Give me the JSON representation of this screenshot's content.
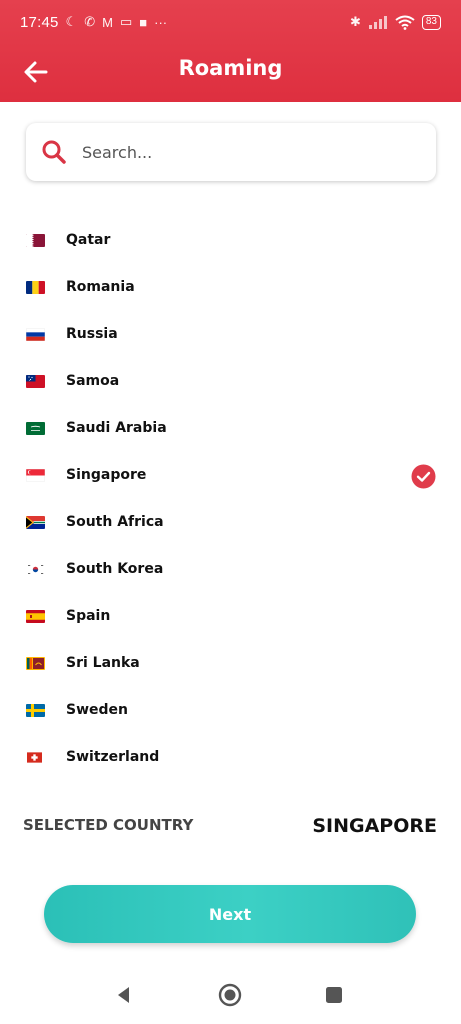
{
  "status_bar": {
    "time": "17:45",
    "battery": "83",
    "left_icons": [
      "moon-icon",
      "call-off-icon",
      "gmail-icon",
      "cast-icon",
      "square-icon",
      "more-icon"
    ],
    "right_icons": [
      "bluetooth-icon",
      "signal-icon",
      "wifi-icon",
      "battery-icon"
    ]
  },
  "header": {
    "title": "Roaming",
    "color": "#e23a48"
  },
  "search": {
    "placeholder": "Search..."
  },
  "countries": [
    {
      "name": "Qatar",
      "flag": "qatar-flag",
      "selected": false
    },
    {
      "name": "Romania",
      "flag": "romania-flag",
      "selected": false
    },
    {
      "name": "Russia",
      "flag": "russia-flag",
      "selected": false
    },
    {
      "name": "Samoa",
      "flag": "samoa-flag",
      "selected": false
    },
    {
      "name": "Saudi Arabia",
      "flag": "saudi-arabia-flag",
      "selected": false
    },
    {
      "name": "Singapore",
      "flag": "singapore-flag",
      "selected": true
    },
    {
      "name": "South Africa",
      "flag": "south-africa-flag",
      "selected": false
    },
    {
      "name": "South Korea",
      "flag": "south-korea-flag",
      "selected": false
    },
    {
      "name": "Spain",
      "flag": "spain-flag",
      "selected": false
    },
    {
      "name": "Sri Lanka",
      "flag": "sri-lanka-flag",
      "selected": false
    },
    {
      "name": "Sweden",
      "flag": "sweden-flag",
      "selected": false
    },
    {
      "name": "Switzerland",
      "flag": "switzerland-flag",
      "selected": false
    }
  ],
  "selection": {
    "label": "SELECTED COUNTRY",
    "value": "SINGAPORE"
  },
  "next_button": {
    "label": "Next",
    "color": "#35c9bf"
  },
  "colors": {
    "accent": "#e23a48",
    "check": "#e03c4b",
    "button": "#35c9bf"
  }
}
